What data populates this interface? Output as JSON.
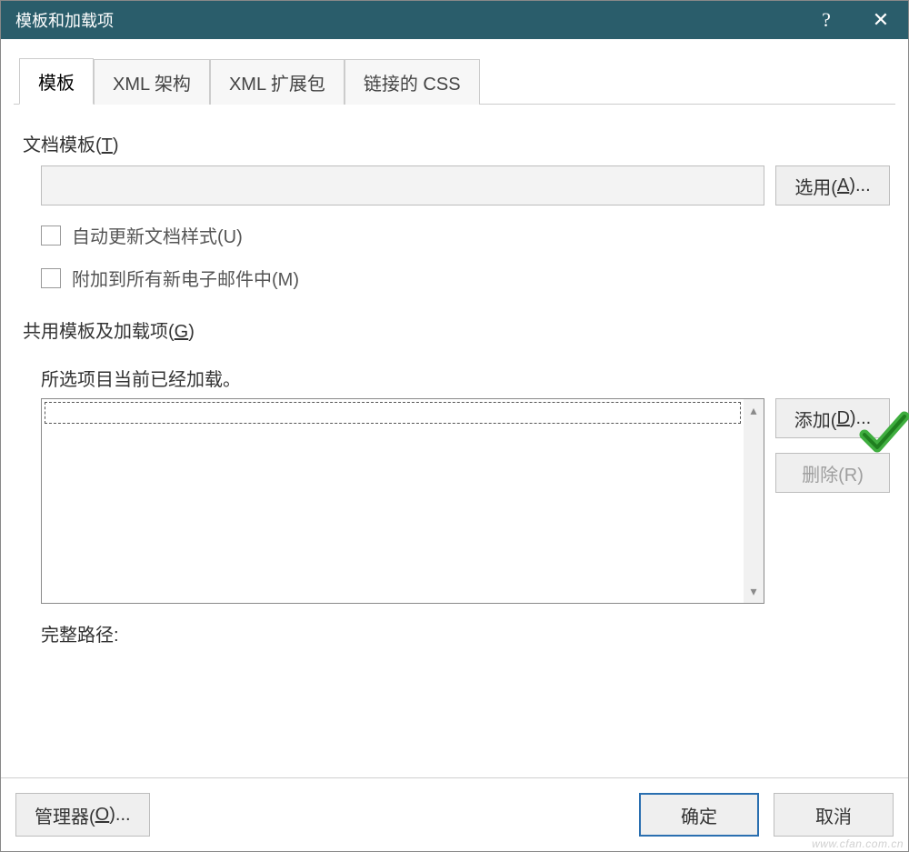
{
  "title": "模板和加载项",
  "titlebar": {
    "help": "?",
    "close": "✕"
  },
  "tabs": [
    {
      "id": "templates",
      "label": "模板",
      "active": true
    },
    {
      "id": "xml-schema",
      "label": "XML 架构",
      "active": false
    },
    {
      "id": "xml-ext",
      "label": "XML 扩展包",
      "active": false
    },
    {
      "id": "linked-css",
      "label": "链接的 CSS",
      "active": false
    }
  ],
  "doc_template": {
    "group_prefix": "文档模板(",
    "group_accel": "T",
    "group_suffix": ")",
    "attach_value": "",
    "select_btn_prefix": "选用(",
    "select_btn_accel": "A",
    "select_btn_suffix": ")...",
    "auto_update_label": "自动更新文档样式(U)",
    "attach_all_label": "附加到所有新电子邮件中(M)"
  },
  "global": {
    "group_prefix": "共用模板及加载项(",
    "group_accel": "G",
    "group_suffix": ")",
    "status_text": "所选项目当前已经加载。",
    "add_btn_prefix": "添加(",
    "add_btn_accel": "D",
    "add_btn_suffix": ")...",
    "remove_btn": "删除(R)",
    "full_path_label": "完整路径:"
  },
  "footer": {
    "organizer_prefix": "管理器(",
    "organizer_accel": "O",
    "organizer_suffix": ")...",
    "ok": "确定",
    "cancel": "取消"
  },
  "watermark": "www.cfan.com.cn"
}
